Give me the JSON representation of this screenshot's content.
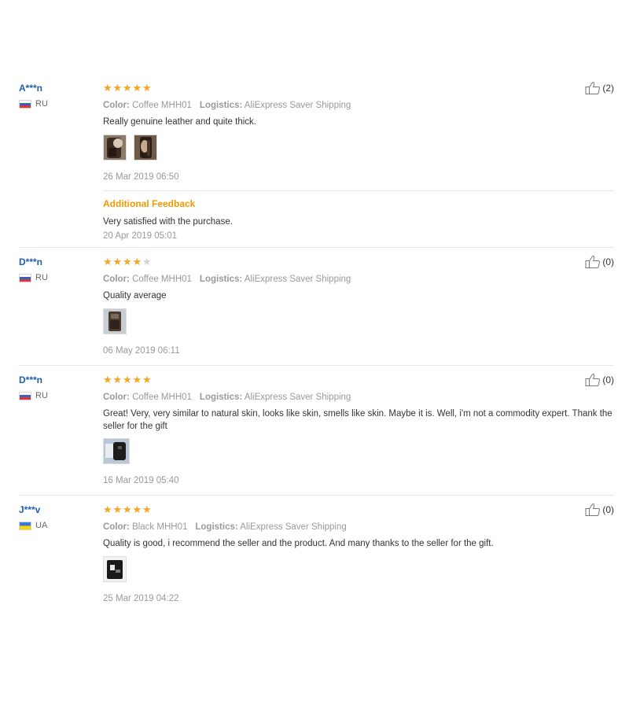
{
  "reviews": [
    {
      "user_name": "A***n",
      "country": "RU",
      "stars": 5,
      "color_label": "Color:",
      "color_value": "Coffee MHH01",
      "logistics_label": "Logistics:",
      "logistics_value": "AliExpress Saver Shipping",
      "text": "Really genuine leather and quite thick.",
      "photo_count": 2,
      "date": "26 Mar 2019 06:50",
      "helpful": "(2)",
      "additional": {
        "title": "Additional Feedback",
        "text": "Very satisfied with the purchase.",
        "date": "20 Apr 2019 05:01"
      }
    },
    {
      "user_name": "D***n",
      "country": "RU",
      "stars": 4,
      "color_label": "Color:",
      "color_value": "Coffee MHH01",
      "logistics_label": "Logistics:",
      "logistics_value": "AliExpress Saver Shipping",
      "text": "Quality average",
      "photo_count": 1,
      "date": "06 May 2019 06:11",
      "helpful": "(0)"
    },
    {
      "user_name": "D***n",
      "country": "RU",
      "stars": 5,
      "color_label": "Color:",
      "color_value": "Coffee MHH01",
      "logistics_label": "Logistics:",
      "logistics_value": "AliExpress Saver Shipping",
      "text": "Great! Very, very similar to natural skin, looks like skin, smells like skin. Maybe it is. Well, i'm not a commodity expert. Thank the seller for the gift",
      "photo_count": 1,
      "date": "16 Mar 2019 05:40",
      "helpful": "(0)"
    },
    {
      "user_name": "J***v",
      "country": "UA",
      "stars": 5,
      "color_label": "Color:",
      "color_value": "Black MHH01",
      "logistics_label": "Logistics:",
      "logistics_value": "AliExpress Saver Shipping",
      "text": "Quality is good, i recommend the seller and the product. And many thanks to the seller for the gift.",
      "photo_count": 1,
      "date": "25 Mar 2019 04:22",
      "helpful": "(0)"
    }
  ],
  "colors": {
    "user_name": "#1f5fa8",
    "star_on": "#f5a623",
    "star_off": "#d4d4d4",
    "additional_title": "#f39800",
    "muted": "#999999",
    "divider": "#e8e8e8"
  },
  "icons": {
    "star": "star-icon",
    "helpful": "thumbs-up-icon"
  }
}
